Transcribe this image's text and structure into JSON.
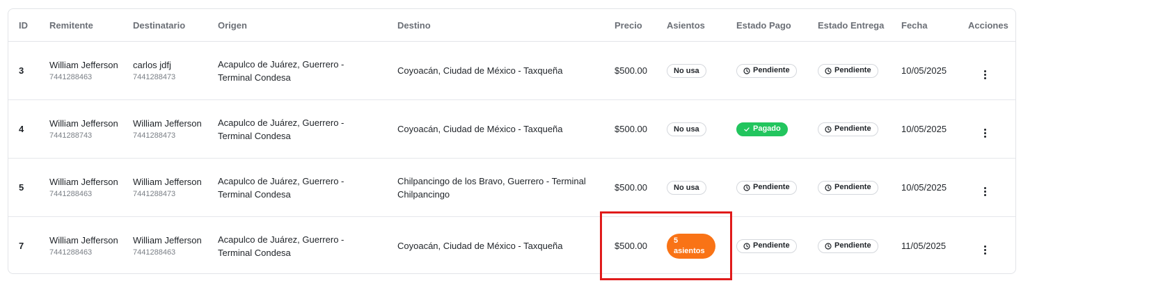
{
  "headers": {
    "id": "ID",
    "sender": "Remitente",
    "recipient": "Destinatario",
    "origin": "Origen",
    "destination": "Destino",
    "price": "Precio",
    "seats": "Asientos",
    "payment_status": "Estado Pago",
    "delivery_status": "Estado Entrega",
    "date": "Fecha",
    "actions": "Acciones"
  },
  "icons": {
    "clock": "clock-icon",
    "check": "check-icon",
    "actions": "more-vertical-icon"
  },
  "colors": {
    "paid": "#22c55e",
    "seats_badge": "#f97316",
    "highlight": "#e01b1b"
  },
  "rows": [
    {
      "id": "3",
      "sender_name": "William Jefferson",
      "sender_phone": "7441288463",
      "recipient_name": "carlos jdfj",
      "recipient_phone": "7441288473",
      "origin": "Acapulco de Juárez, Guerrero - Terminal Condesa",
      "destination": "Coyoacán, Ciudad de México - Taxqueña",
      "price": "$500.00",
      "seats": "No usa",
      "payment_status": "Pendiente",
      "delivery_status": "Pendiente",
      "date": "10/05/2025"
    },
    {
      "id": "4",
      "sender_name": "William Jefferson",
      "sender_phone": "7441288743",
      "recipient_name": "William Jefferson",
      "recipient_phone": "7441288473",
      "origin": "Acapulco de Juárez, Guerrero - Terminal Condesa",
      "destination": "Coyoacán, Ciudad de México - Taxqueña",
      "price": "$500.00",
      "seats": "No usa",
      "payment_status": "Pagado",
      "delivery_status": "Pendiente",
      "date": "10/05/2025"
    },
    {
      "id": "5",
      "sender_name": "William Jefferson",
      "sender_phone": "7441288463",
      "recipient_name": "William Jefferson",
      "recipient_phone": "7441288473",
      "origin": "Acapulco de Juárez, Guerrero - Terminal Condesa",
      "destination": "Chilpancingo de los Bravo, Guerrero - Terminal Chilpancingo",
      "price": "$500.00",
      "seats": "No usa",
      "payment_status": "Pendiente",
      "delivery_status": "Pendiente",
      "date": "10/05/2025"
    },
    {
      "id": "7",
      "sender_name": "William Jefferson",
      "sender_phone": "7441288463",
      "recipient_name": "William Jefferson",
      "recipient_phone": "7441288463",
      "origin": "Acapulco de Juárez, Guerrero - Terminal Condesa",
      "destination": "Coyoacán, Ciudad de México - Taxqueña",
      "price": "$500.00",
      "seats": "5 asientos",
      "payment_status": "Pendiente",
      "delivery_status": "Pendiente",
      "date": "11/05/2025"
    }
  ]
}
